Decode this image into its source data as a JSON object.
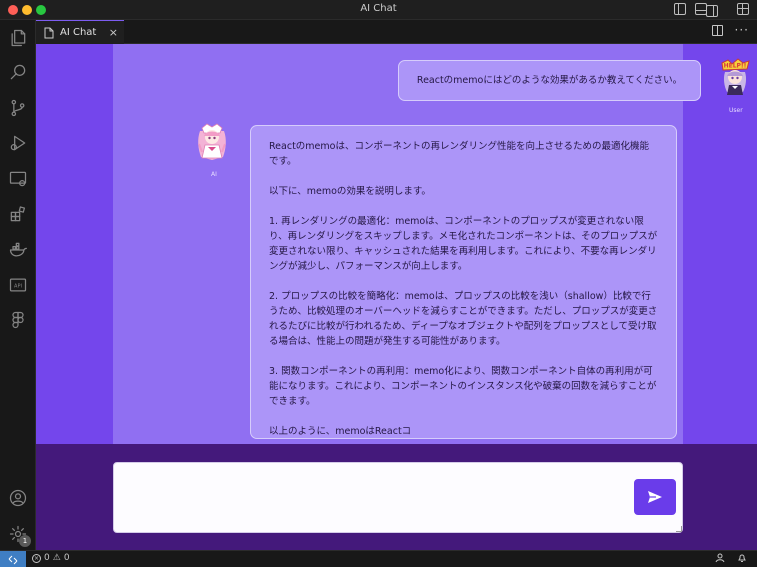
{
  "window": {
    "title": "AI Chat"
  },
  "tab": {
    "label": "AI Chat",
    "close": "×"
  },
  "activity": {
    "settings_badge": "1"
  },
  "chat": {
    "user_message": "Reactのmemoにはどのような効果があるか教えてください。",
    "user_label": "User",
    "ai_label": "AI",
    "ai_message": "Reactのmemoは、コンポーネントの再レンダリング性能を向上させるための最適化機能です。\n\n以下に、memoの効果を説明します。\n\n1. 再レンダリングの最適化：memoは、コンポーネントのプロップスが変更されない限り、再レンダリングをスキップします。メモ化されたコンポーネントは、そのプロップスが変更されない限り、キャッシュされた結果を再利用します。これにより、不要な再レンダリングが減少し、パフォーマンスが向上します。\n\n2. プロップスの比較を簡略化：memoは、プロップスの比較を浅い（shallow）比較で行うため、比較処理のオーバーヘッドを減らすことができます。ただし、プロップスが変更されるたびに比較が行われるため、ディープなオブジェクトや配列をプロップスとして受け取る場合は、性能上の問題が発生する可能性があります。\n\n3. 関数コンポーネントの再利用：memo化により、関数コンポーネント自体の再利用が可能になります。これにより、コンポーネントのインスタンス化や破棄の回数を減らすことができます。\n\n以上のように、memoはReactコ"
  },
  "input": {
    "value": ""
  },
  "status": {
    "errors": "0",
    "warnings": "0"
  },
  "colors": {
    "chat_bg": "#7446ec",
    "chat_column": "#906ff2",
    "bubble": "#ac95f8",
    "input_area": "#44197b",
    "send_button": "#6a3cea"
  }
}
